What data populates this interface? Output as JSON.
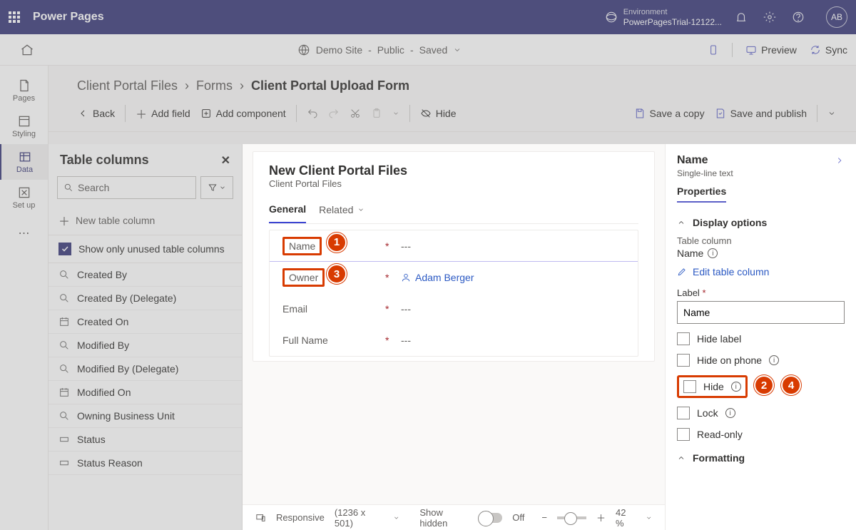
{
  "brand": {
    "product": "Power Pages",
    "env_label": "Environment",
    "env_name": "PowerPagesTrial-12122...",
    "avatar": "AB"
  },
  "sitebar": {
    "site": "Demo Site",
    "visibility": "Public",
    "state": "Saved",
    "preview": "Preview",
    "sync": "Sync"
  },
  "rail": {
    "pages": "Pages",
    "styling": "Styling",
    "data": "Data",
    "setup": "Set up"
  },
  "crumbs": {
    "a": "Client Portal Files",
    "b": "Forms",
    "c": "Client Portal Upload Form"
  },
  "toolbar": {
    "back": "Back",
    "add_field": "Add field",
    "add_component": "Add component",
    "hide": "Hide",
    "save_copy": "Save a copy",
    "save_publish": "Save and publish"
  },
  "colpanel": {
    "title": "Table columns",
    "search_ph": "Search",
    "new_col": "New table column",
    "show_unused": "Show only unused table columns",
    "items": [
      {
        "label": "Created By",
        "icon": "search"
      },
      {
        "label": "Created By (Delegate)",
        "icon": "search"
      },
      {
        "label": "Created On",
        "icon": "cal"
      },
      {
        "label": "Modified By",
        "icon": "search"
      },
      {
        "label": "Modified By (Delegate)",
        "icon": "search"
      },
      {
        "label": "Modified On",
        "icon": "cal"
      },
      {
        "label": "Owning Business Unit",
        "icon": "search"
      },
      {
        "label": "Status",
        "icon": "rect"
      },
      {
        "label": "Status Reason",
        "icon": "rect"
      }
    ]
  },
  "form": {
    "title": "New Client Portal Files",
    "subtitle": "Client Portal Files",
    "tab_general": "General",
    "tab_related": "Related",
    "rows": [
      {
        "label": "Name",
        "value": "---",
        "hl": true,
        "callout": "1"
      },
      {
        "label": "Owner",
        "value": "Adam Berger",
        "link": true,
        "hl": true,
        "callout": "3",
        "person": true
      },
      {
        "label": "Email",
        "value": "---"
      },
      {
        "label": "Full Name",
        "value": "---"
      }
    ]
  },
  "statusbar": {
    "responsive": "Responsive",
    "dims": "(1236 x 501)",
    "show_hidden": "Show hidden",
    "off": "Off",
    "zoom": "42 %"
  },
  "prop": {
    "name": "Name",
    "type": "Single-line text",
    "tab": "Properties",
    "display_options": "Display options",
    "table_column": "Table column",
    "col_name": "Name",
    "edit": "Edit table column",
    "label_lbl": "Label",
    "label_val": "Name",
    "hide_label": "Hide label",
    "hide_phone": "Hide on phone",
    "hide": "Hide",
    "lock": "Lock",
    "readonly": "Read-only",
    "formatting": "Formatting",
    "callouts": {
      "near_hide_a": "2",
      "near_hide_b": "4"
    }
  }
}
